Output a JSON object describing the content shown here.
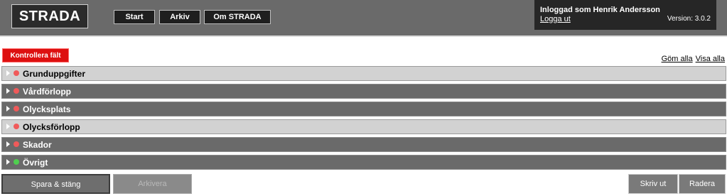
{
  "header": {
    "logo": "STRADA",
    "nav": [
      {
        "label": "Start"
      },
      {
        "label": "Arkiv"
      },
      {
        "label": "Om STRADA"
      }
    ],
    "user": {
      "logged_in_label": "Inloggad som Henrik Andersson",
      "logout_label": "Logga ut",
      "version": "Version: 3.0.2"
    }
  },
  "actions": {
    "check_fields": "Kontrollera fält",
    "hide_all": "Göm alla",
    "show_all": "Visa alla"
  },
  "sections": [
    {
      "label": "Grunduppgifter",
      "status": "red"
    },
    {
      "label": "Vårdförlopp",
      "status": "red"
    },
    {
      "label": "Olycksplats",
      "status": "red"
    },
    {
      "label": "Olycksförlopp",
      "status": "red"
    },
    {
      "label": "Skador",
      "status": "red"
    },
    {
      "label": "Övrigt",
      "status": "green"
    }
  ],
  "colors": {
    "status_red": "#f05a5a",
    "status_green": "#4fcf4f",
    "alert_red": "#dd1010"
  },
  "footer": {
    "save_close": "Spara & stäng",
    "archive": "Arkivera",
    "print": "Skriv ut",
    "delete": "Radera"
  }
}
